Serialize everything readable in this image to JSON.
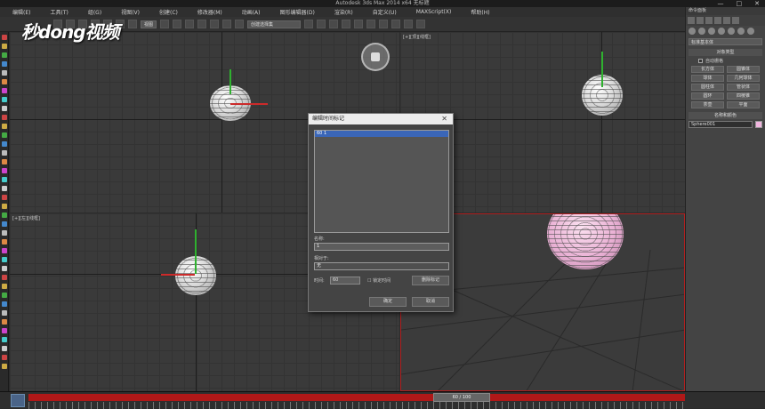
{
  "window": {
    "title": "Autodesk 3ds Max  2014 x64    无标题",
    "controls": [
      "—",
      "□",
      "✕"
    ]
  },
  "watermark": "秒dong视频",
  "menu": [
    "编辑(E)",
    "工具(T)",
    "组(G)",
    "视图(V)",
    "创建(C)",
    "修改器(M)",
    "动画(A)",
    "图形编辑器(D)",
    "渲染(R)",
    "自定义(U)",
    "MAXScript(X)",
    "帮助(H)"
  ],
  "toolbar": {
    "view_dropdown": "视图",
    "selection_set": "创建选择集"
  },
  "viewports": {
    "top_label": "[+][顶][线框]",
    "left_label": "[+][左][线框]"
  },
  "command_panel": {
    "title": "命令面板",
    "category_dropdown": "标准基本体",
    "object_type_header": "对象类型",
    "autogrid_label": "自动栅格",
    "buttons": [
      "长方体",
      "圆锥体",
      "球体",
      "几何球体",
      "圆柱体",
      "管状体",
      "圆环",
      "四棱锥",
      "茶壶",
      "平面"
    ],
    "name_color_header": "名称和颜色",
    "object_name": "Sphere001",
    "object_color": "#f2b6e0"
  },
  "dialog": {
    "title": "编辑时间标记",
    "close": "✕",
    "list_items": [
      "60 1"
    ],
    "name_label": "名称:",
    "name_value": "1",
    "relative_label": "相对于:",
    "relative_value": "无",
    "time_label": "时间:",
    "time_value": "60",
    "lock_label": "锁定时间",
    "delete_button": "删除标记",
    "ok_button": "确定",
    "cancel_button": "取消"
  },
  "timeline": {
    "frame_display": "60 / 100"
  }
}
